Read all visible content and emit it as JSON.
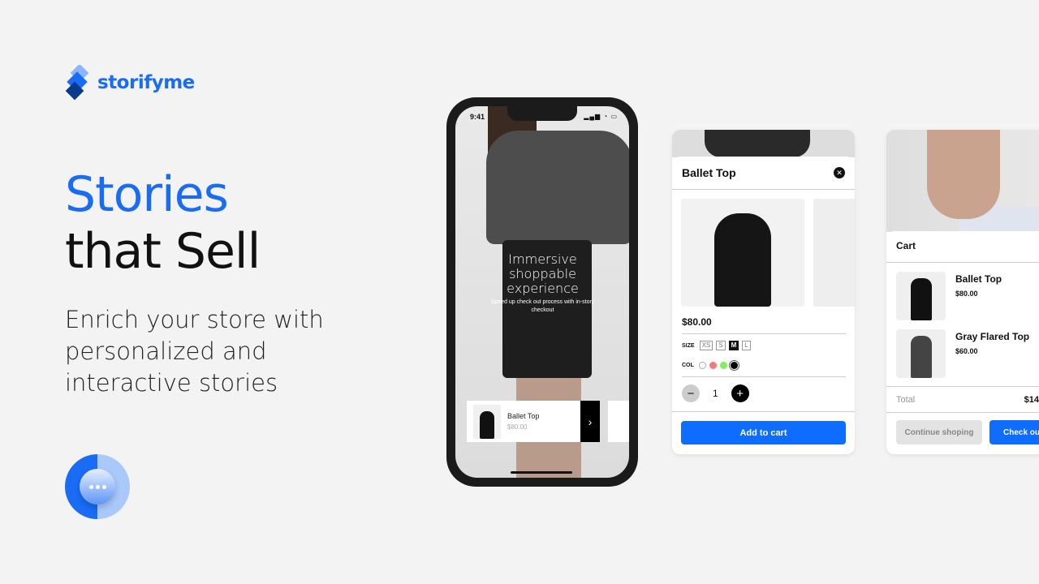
{
  "brand": {
    "name": "storifyme",
    "color": "#1a6cf5"
  },
  "hero": {
    "line1": "Stories",
    "line2": "that Sell",
    "subtitle": "Enrich your store with personalized and interactive stories"
  },
  "chat": {
    "icon": "chat-bubble-icon"
  },
  "phone": {
    "time": "9:41",
    "status_icons": "signal wifi battery",
    "overlay_title": "Immersive shoppable experience",
    "overlay_sub": "Speed up check out process with in-story checkout",
    "product": {
      "name": "Ballet Top",
      "price": "$80.00"
    }
  },
  "product_sheet": {
    "title": "Ballet Top",
    "price": "$80.00",
    "size_label": "SIZE",
    "sizes": [
      "XS",
      "S",
      "M",
      "L"
    ],
    "selected_size": "M",
    "color_label": "COL",
    "colors": [
      "#ffffff",
      "#f77a7a",
      "#7ef05a",
      "#000000"
    ],
    "quantity": "1",
    "add_label": "Add to cart",
    "accent": "#0e6cff"
  },
  "cart": {
    "title": "Cart",
    "items": [
      {
        "name": "Ballet Top",
        "price": "$80.00"
      },
      {
        "name": "Gray Flared Top",
        "price": "$60.00"
      }
    ],
    "total_label": "Total",
    "total_value": "$14",
    "continue_label": "Continue shoping",
    "checkout_label": "Check ou"
  }
}
